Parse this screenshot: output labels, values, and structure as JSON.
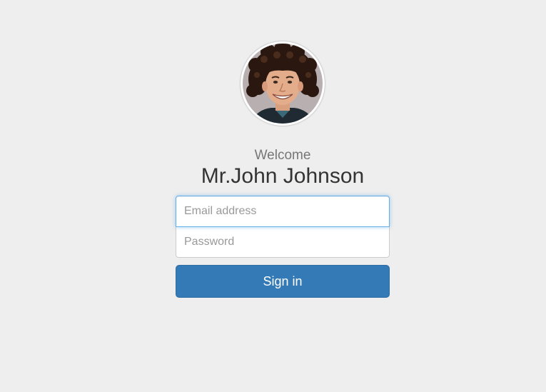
{
  "profile": {
    "welcome_text": "Welcome",
    "user_name": "Mr.John Johnson",
    "avatar_description": "avatar"
  },
  "form": {
    "email_placeholder": "Email address",
    "email_value": "",
    "password_placeholder": "Password",
    "password_value": "",
    "submit_label": "Sign in",
    "focused_field": "email"
  },
  "colors": {
    "background": "#eeeeee",
    "primary_button": "#337ab7",
    "focus_border": "#66afe9",
    "name_text": "#333333",
    "welcome_text": "#777777"
  }
}
